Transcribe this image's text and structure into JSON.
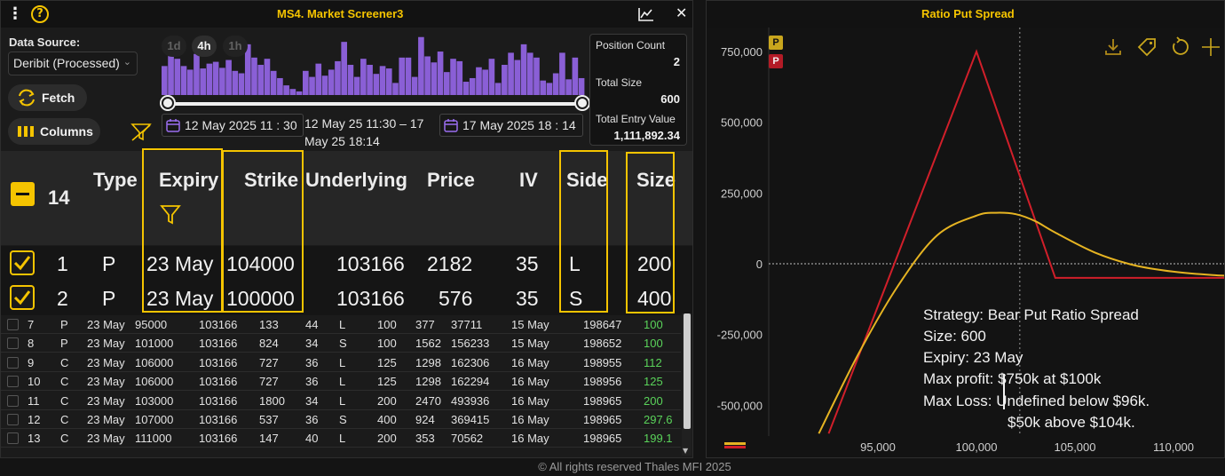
{
  "screener": {
    "title": "MS4. Market Screener3",
    "data_source_label": "Data Source:",
    "data_source_value": "Deribit (Processed)",
    "fetch_label": "Fetch",
    "columns_label": "Columns",
    "ranges": [
      "1d",
      "4h",
      "1h"
    ],
    "date_start": "12 May 2025  11 : 30",
    "date_end": "17 May 2025  18 : 14",
    "range_text": "12 May 25 11:30 – 17 May 25 18:14",
    "histogram_bars": [
      0.48,
      0.78,
      0.6,
      0.48,
      0.42,
      0.68,
      0.44,
      0.52,
      0.55,
      0.45,
      0.58,
      0.4,
      0.36,
      0.84,
      0.62,
      0.5,
      0.6,
      0.4,
      0.28,
      0.16,
      0.1,
      0.06,
      0.4,
      0.3,
      0.52,
      0.32,
      0.42,
      0.56,
      0.88,
      0.5,
      0.3,
      0.6,
      0.5,
      0.35,
      0.48,
      0.44,
      0.2,
      0.62,
      0.62,
      0.3,
      0.96,
      0.64,
      0.54,
      0.72,
      0.38,
      0.6,
      0.56,
      0.22,
      0.28,
      0.46,
      0.42,
      0.6,
      0.2,
      0.5,
      0.7,
      0.58,
      0.84,
      0.7,
      0.62,
      0.24,
      0.2,
      0.36,
      0.7,
      0.26,
      0.62,
      0.28
    ],
    "histogram_color": "#8a5fd6",
    "stats": {
      "position_count_label": "Position Count",
      "position_count": "2",
      "total_size_label": "Total Size",
      "total_size": "600",
      "total_entry_label": "Total Entry Value",
      "total_entry": "1,111,892.34"
    },
    "header": {
      "count": "14",
      "type": "Type",
      "expiry": "Expiry",
      "strike": "Strike",
      "underlying": "Underlying",
      "price": "Price",
      "iv": "IV",
      "side": "Side",
      "size": "Size"
    },
    "selected_rows": [
      {
        "n": "1",
        "type": "P",
        "expiry": "23 May",
        "strike": "104000",
        "underlying": "103166",
        "price": "2182",
        "iv": "35",
        "side": "L",
        "size": "200"
      },
      {
        "n": "2",
        "type": "P",
        "expiry": "23 May",
        "strike": "100000",
        "underlying": "103166",
        "price": "576",
        "iv": "35",
        "side": "S",
        "size": "400"
      }
    ],
    "rows": [
      {
        "n": "7",
        "type": "P",
        "expiry": "23 May",
        "strike": "95000",
        "underlying": "103166",
        "price": "133",
        "iv": "44",
        "side": "L",
        "c1": "100",
        "c2": "377",
        "c3": "37711",
        "date": "15 May",
        "id": "198647",
        "size": "100"
      },
      {
        "n": "8",
        "type": "P",
        "expiry": "23 May",
        "strike": "101000",
        "underlying": "103166",
        "price": "824",
        "iv": "34",
        "side": "S",
        "c1": "100",
        "c2": "1562",
        "c3": "156233",
        "date": "15 May",
        "id": "198652",
        "size": "100"
      },
      {
        "n": "9",
        "type": "C",
        "expiry": "23 May",
        "strike": "106000",
        "underlying": "103166",
        "price": "727",
        "iv": "36",
        "side": "L",
        "c1": "125",
        "c2": "1298",
        "c3": "162306",
        "date": "16 May",
        "id": "198955",
        "size": "112"
      },
      {
        "n": "10",
        "type": "C",
        "expiry": "23 May",
        "strike": "106000",
        "underlying": "103166",
        "price": "727",
        "iv": "36",
        "side": "L",
        "c1": "125",
        "c2": "1298",
        "c3": "162294",
        "date": "16 May",
        "id": "198956",
        "size": "125"
      },
      {
        "n": "11",
        "type": "C",
        "expiry": "23 May",
        "strike": "103000",
        "underlying": "103166",
        "price": "1800",
        "iv": "34",
        "side": "L",
        "c1": "200",
        "c2": "2470",
        "c3": "493936",
        "date": "16 May",
        "id": "198965",
        "size": "200"
      },
      {
        "n": "12",
        "type": "C",
        "expiry": "23 May",
        "strike": "107000",
        "underlying": "103166",
        "price": "537",
        "iv": "36",
        "side": "S",
        "c1": "400",
        "c2": "924",
        "c3": "369415",
        "date": "16 May",
        "id": "198965",
        "size": "297.6"
      },
      {
        "n": "13",
        "type": "C",
        "expiry": "23 May",
        "strike": "111000",
        "underlying": "103166",
        "price": "147",
        "iv": "40",
        "side": "L",
        "c1": "200",
        "c2": "353",
        "c3": "70562",
        "date": "16 May",
        "id": "198965",
        "size": "199.1"
      }
    ]
  },
  "payoff": {
    "title": "Ratio Put Spread",
    "legend_p1": "P",
    "legend_p2": "P",
    "summary": {
      "strategy": "Strategy: Bear Put Ratio Spread",
      "size": "Size: 600",
      "expiry": "Expiry: 23 May",
      "max_profit": "Max profit: $750k at $100k",
      "max_loss": "Max Loss: Undefined below $96k.",
      "max_loss_2": "$50k above $104k."
    }
  },
  "chart_data": {
    "type": "line",
    "xlim": [
      88000,
      114000
    ],
    "ylim": [
      -600000,
      800000
    ],
    "x_ticks": [
      95000,
      100000,
      105000,
      110000
    ],
    "x_tick_labels": [
      "95,000",
      "100,000",
      "105,000",
      "110,000"
    ],
    "y_ticks": [
      -500000,
      -250000,
      0,
      250000,
      500000,
      750000
    ],
    "y_tick_labels": [
      "-500,000",
      "-250,000",
      "0",
      "250,000",
      "500,000",
      "750,000"
    ],
    "series": [
      {
        "color": "#d11f2a",
        "x": [
          92500,
          100000,
          104000,
          114000
        ],
        "y": [
          -600000,
          750000,
          -50000,
          -50000
        ]
      },
      {
        "color": "#e6b422",
        "x": [
          92000,
          94000,
          96000,
          98000,
          100000,
          101000,
          102000,
          103000,
          104000,
          106000,
          108000,
          110000,
          112000,
          114000
        ],
        "y": [
          -600000,
          -320000,
          -80000,
          100000,
          170000,
          180000,
          175000,
          150000,
          110000,
          40000,
          -5000,
          -28000,
          -40000,
          -46000
        ]
      }
    ],
    "crosshair_x": 102200,
    "grid": false,
    "colors": {
      "accent": "#f5c400",
      "loss_line": "#d11f2a",
      "t0_line": "#e6b422"
    }
  },
  "footer": "© All rights reserved Thales MFI 2025"
}
